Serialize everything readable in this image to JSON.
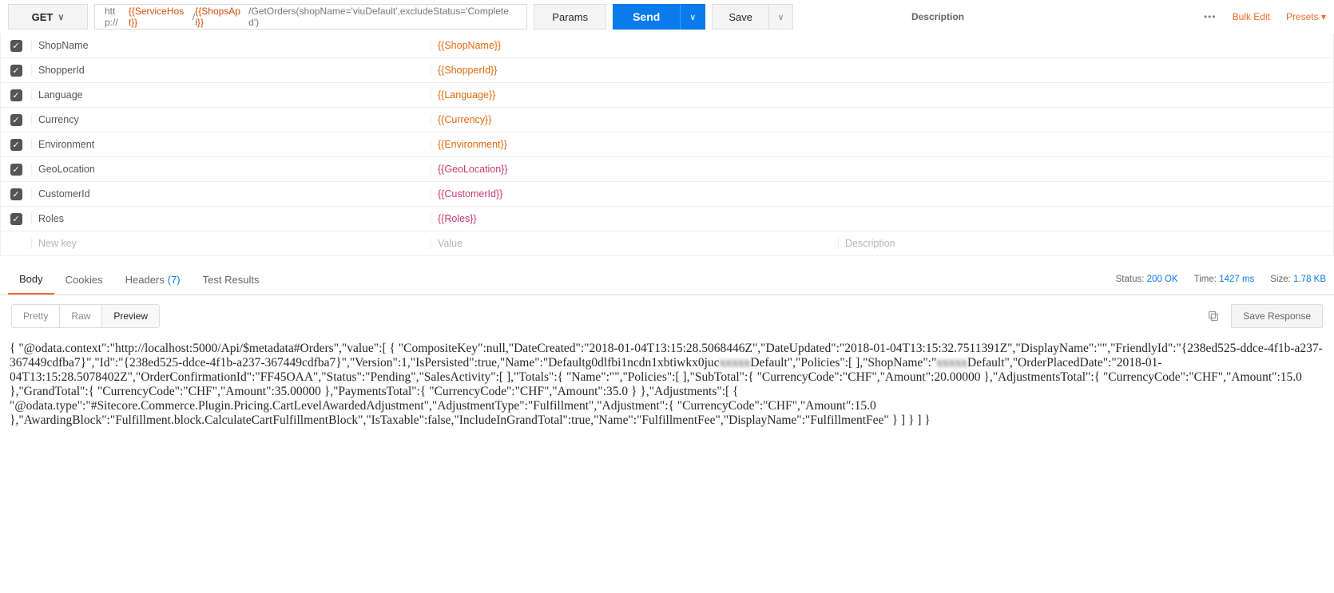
{
  "request": {
    "method": "GET",
    "url_parts": [
      {
        "t": "txt",
        "v": "http://"
      },
      {
        "t": "var",
        "v": "{{ServiceHost}}"
      },
      {
        "t": "txt",
        "v": "/"
      },
      {
        "t": "var",
        "v": "{{ShopsApi}}"
      },
      {
        "t": "txt",
        "v": "/GetOrders(shopName='viuDefault',excludeStatus='Completed')"
      }
    ],
    "params_btn": "Params",
    "send_btn": "Send",
    "save_btn": "Save"
  },
  "top_right": {
    "desc_label": "Description",
    "bulk_edit": "Bulk Edit",
    "presets": "Presets ▾"
  },
  "params": [
    {
      "key": "ShopName",
      "value": "{{ShopName}}",
      "style": "orange"
    },
    {
      "key": "ShopperId",
      "value": "{{ShopperId}}",
      "style": "orange"
    },
    {
      "key": "Language",
      "value": "{{Language}}",
      "style": "orange"
    },
    {
      "key": "Currency",
      "value": "{{Currency}}",
      "style": "orange"
    },
    {
      "key": "Environment",
      "value": "{{Environment}}",
      "style": "orange"
    },
    {
      "key": "GeoLocation",
      "value": "{{GeoLocation}}",
      "style": "pink"
    },
    {
      "key": "CustomerId",
      "value": "{{CustomerId}}",
      "style": "pink"
    },
    {
      "key": "Roles",
      "value": "{{Roles}}",
      "style": "pink"
    }
  ],
  "new_row": {
    "key_ph": "New key",
    "val_ph": "Value",
    "desc_ph": "Description"
  },
  "resp_tabs": {
    "body": "Body",
    "cookies": "Cookies",
    "headers": "Headers",
    "headers_count": "(7)",
    "tests": "Test Results"
  },
  "resp_meta": {
    "status_l": "Status:",
    "status_v": "200 OK",
    "time_l": "Time:",
    "time_v": "1427 ms",
    "size_l": "Size:",
    "size_v": "1.78 KB"
  },
  "view": {
    "pretty": "Pretty",
    "raw": "Raw",
    "preview": "Preview",
    "save_resp": "Save Response"
  },
  "json_body": {
    "pre_blur1": "{ \"@odata.context\":\"http://localhost:5000/Api/$metadata#Orders\",\"value\":[ { \"CompositeKey\":null,\"DateCreated\":\"2018-01-04T13:15:28.5068446Z\",\"DateUpdated\":\"2018-01-04T13:15:32.7511391Z\",\"DisplayName\":\"\",\"FriendlyId\":\"{238ed525-ddce-4f1b-a237-367449cdfba7}\",\"Id\":\"{238ed525-ddce-4f1b-a237-367449cdfba7}\",\"Version\":1,\"IsPersisted\":true,\"Name\":\"Defaultg0dlfbi1ncdn1xbtiwkx0juc",
    "blur1": "xxxxx",
    "post_blur1": "Default\",\"Policies\":[ ],\"ShopName\":\"",
    "blur2": "xxxxx",
    "post_blur2": "Default\",\"OrderPlacedDate\":\"2018-01-04T13:15:28.5078402Z\",\"OrderConfirmationId\":\"FF45OAA\",\"Status\":\"Pending\",\"SalesActivity\":[ ],\"Totals\":{ \"Name\":\"\",\"Policies\":[ ],\"SubTotal\":{ \"CurrencyCode\":\"CHF\",\"Amount\":20.00000 },\"AdjustmentsTotal\":{ \"CurrencyCode\":\"CHF\",\"Amount\":15.0 },\"GrandTotal\":{ \"CurrencyCode\":\"CHF\",\"Amount\":35.00000 },\"PaymentsTotal\":{ \"CurrencyCode\":\"CHF\",\"Amount\":35.0 } },\"Adjustments\":[ { \"@odata.type\":\"#Sitecore.Commerce.Plugin.Pricing.CartLevelAwardedAdjustment\",\"AdjustmentType\":\"Fulfillment\",\"Adjustment\":{ \"CurrencyCode\":\"CHF\",\"Amount\":15.0 },\"AwardingBlock\":\"Fulfillment.block.CalculateCartFulfillmentBlock\",\"IsTaxable\":false,\"IncludeInGrandTotal\":true,\"Name\":\"FulfillmentFee\",\"DisplayName\":\"FulfillmentFee\" } ] } ] }"
  }
}
